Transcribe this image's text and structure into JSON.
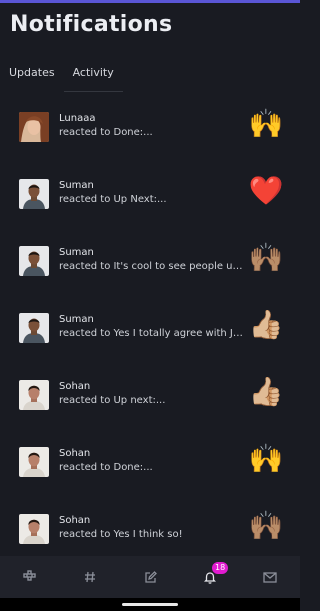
{
  "title": "Notifications",
  "tabs": [
    {
      "label": "Updates"
    },
    {
      "label": "Activity"
    }
  ],
  "notifications": [
    {
      "name": "Lunaaa",
      "text": "reacted to Done:...",
      "emoji": "🙌",
      "avatar": "avatar-lunaaa"
    },
    {
      "name": "Suman",
      "text": "reacted to Up Next:...",
      "emoji": "❤️",
      "avatar": "avatar-suman"
    },
    {
      "name": "Suman",
      "text": "reacted to It's cool to see people usin...",
      "emoji": "🙌🏽",
      "avatar": "avatar-suman"
    },
    {
      "name": "Suman",
      "text": "reacted to Yes I totally agree with Jak...",
      "emoji": "👍🏼",
      "avatar": "avatar-suman"
    },
    {
      "name": "Sohan",
      "text": "reacted to Up next:...",
      "emoji": "👍🏼",
      "avatar": "avatar-sohan"
    },
    {
      "name": "Sohan",
      "text": "reacted to Done:...",
      "emoji": "🙌",
      "avatar": "avatar-sohan"
    },
    {
      "name": "Sohan",
      "text": "reacted to Yes I think so!",
      "emoji": "🙌🏽",
      "avatar": "avatar-sohan"
    }
  ],
  "bottom_nav": {
    "items": [
      {
        "icon": "spaces-icon"
      },
      {
        "icon": "hashtag-icon"
      },
      {
        "icon": "compose-icon"
      },
      {
        "icon": "bell-icon",
        "badge": "18"
      },
      {
        "icon": "mail-icon"
      }
    ]
  },
  "colors": {
    "background": "#191b22",
    "accent": "#5a56d6",
    "badge": "#e11bd0",
    "nav": "#20222a"
  }
}
